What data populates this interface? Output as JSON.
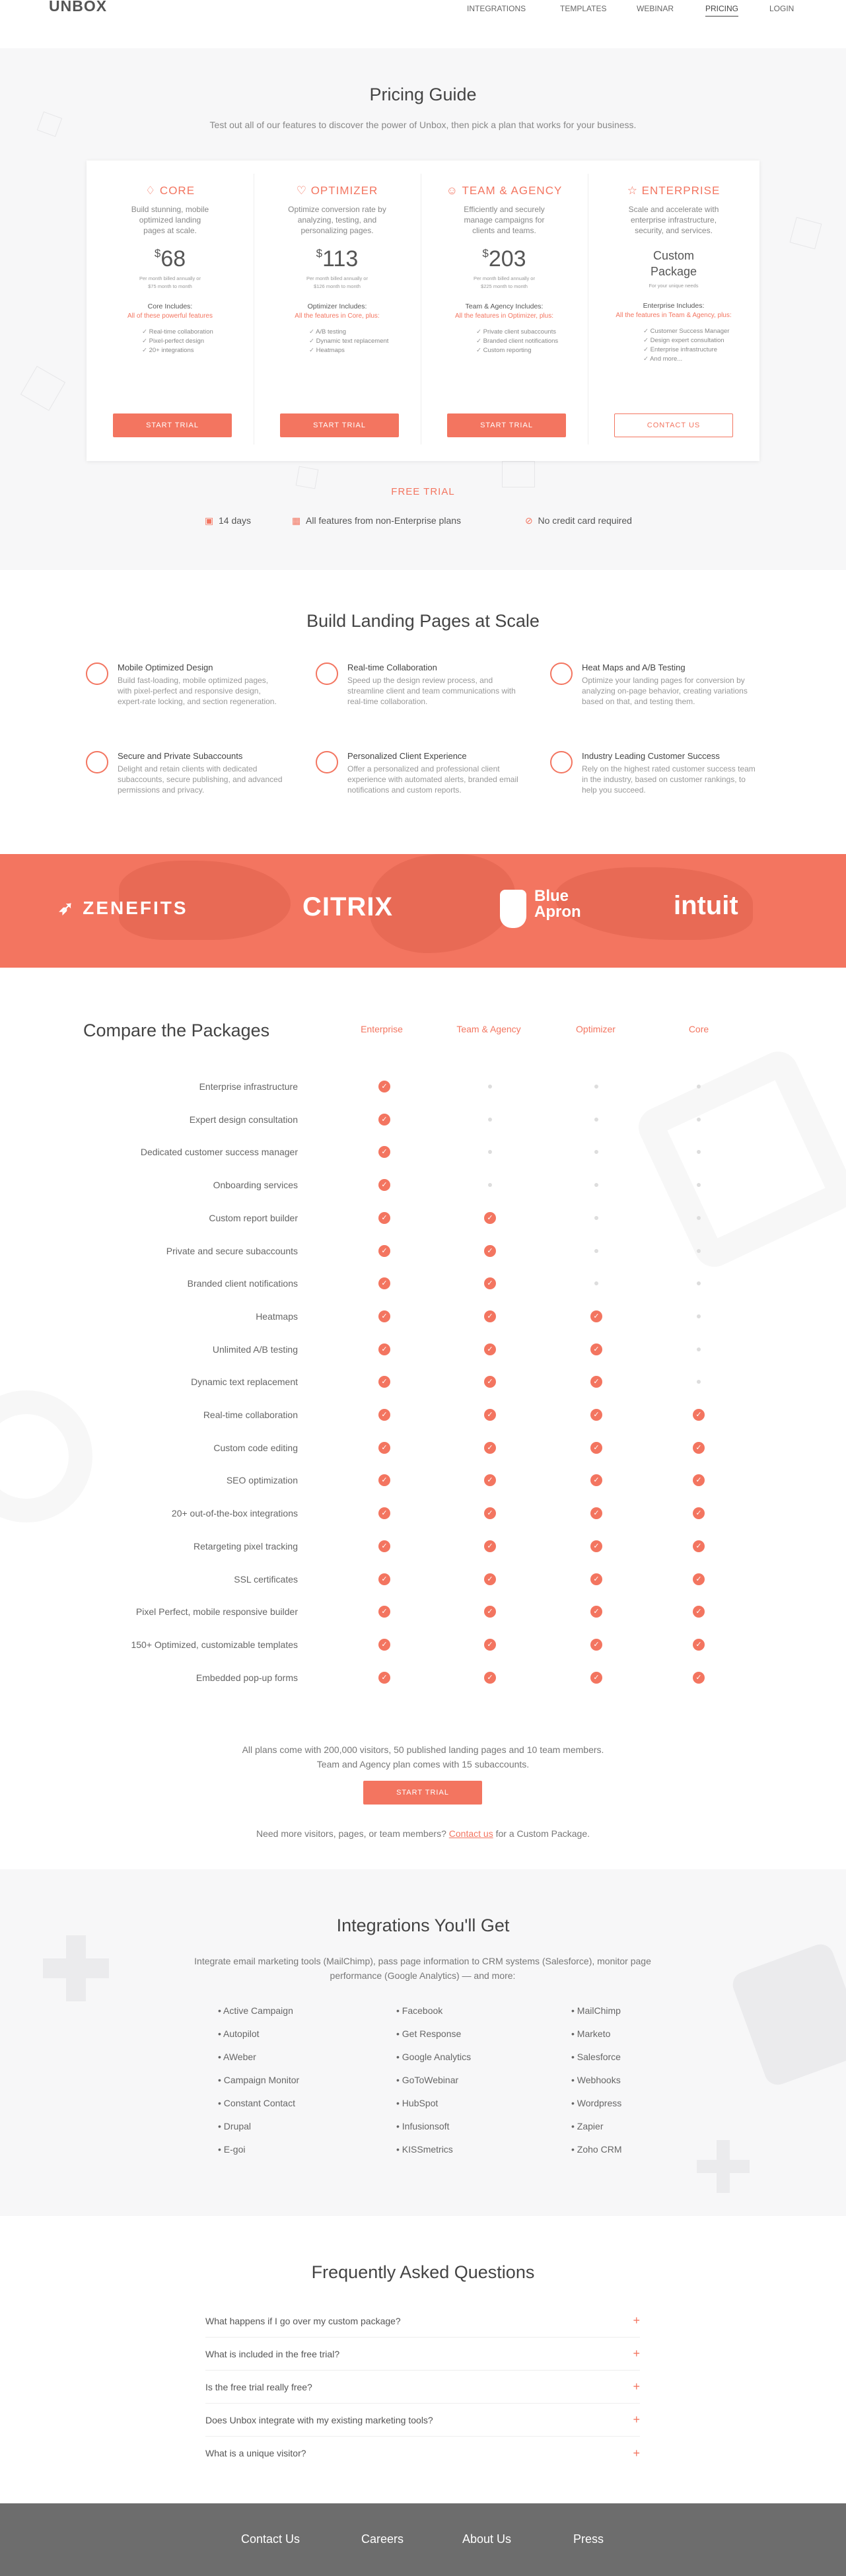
{
  "nav": {
    "logo": "UNBOX",
    "items": [
      "INTEGRATIONS",
      "TEMPLATES",
      "WEBINAR",
      "PRICING",
      "LOGIN"
    ]
  },
  "pricing": {
    "title": "Pricing Guide",
    "subtitle": "Test out all of our features to discover the power of Unbox, then pick a plan that works for your business.",
    "plans": [
      {
        "name": "CORE",
        "desc": "Build stunning, mobile optimized landing pages at scale.",
        "price": "68",
        "note": "Per month billed annually or $75 month to month",
        "includes": "Core Includes:",
        "sub": "All of these powerful features",
        "features": [
          "Real-time collaboration",
          "Pixel-perfect design",
          "20+ integrations"
        ],
        "cta": "START TRIAL"
      },
      {
        "name": "OPTIMIZER",
        "desc": "Optimize conversion rate by analyzing, testing, and personalizing pages.",
        "price": "113",
        "note": "Per month billed annually or $126 month to month",
        "includes": "Optimizer Includes:",
        "sub": "All the features in Core, plus:",
        "features": [
          "A/B testing",
          "Dynamic text replacement",
          "Heatmaps"
        ],
        "cta": "START TRIAL"
      },
      {
        "name": "TEAM & AGENCY",
        "desc": "Efficiently and securely manage campaigns for clients and teams.",
        "price": "203",
        "note": "Per month billed annually or $225 month to month",
        "includes": "Team & Agency Includes:",
        "sub": "All the features in Optimizer, plus:",
        "features": [
          "Private client subaccounts",
          "Branded client notifications",
          "Custom reporting"
        ],
        "cta": "START TRIAL"
      },
      {
        "name": "ENTERPRISE",
        "desc": "Scale and accelerate with enterprise infrastructure, security, and services.",
        "price": "Custom Package",
        "note": "For your unique needs",
        "includes": "Enterprise Includes:",
        "sub": "All the features in Team & Agency, plus:",
        "features": [
          "Customer Success Manager",
          "Design expert consultation",
          "Enterprise infrastructure",
          "And more..."
        ],
        "cta": "CONTACT US"
      }
    ],
    "trial": {
      "title": "FREE TRIAL",
      "items": [
        "14 days",
        "All features from non-Enterprise plans",
        "No credit card required"
      ]
    }
  },
  "scale": {
    "title": "Build Landing Pages at Scale",
    "features": [
      {
        "t": "Mobile Optimized Design",
        "d": "Build fast-loading, mobile optimized pages, with pixel-perfect and responsive design, expert-rate locking, and section regeneration.",
        "icon": "mobile-icon"
      },
      {
        "t": "Real-time Collaboration",
        "d": "Speed up the design review process, and streamline client and team communications with real-time collaboration.",
        "icon": "collaboration-icon"
      },
      {
        "t": "Heat Maps and A/B Testing",
        "d": "Optimize your landing pages for conversion by analyzing on-page behavior, creating variations based on that, and testing them.",
        "icon": "heatmap-icon"
      },
      {
        "t": "Secure and Private Subaccounts",
        "d": "Delight and retain clients with dedicated subaccounts, secure publishing, and advanced permissions and privacy.",
        "icon": "subaccounts-icon"
      },
      {
        "t": "Personalized Client Experience",
        "d": "Offer a personalized and professional client experience with automated alerts, branded email notifications and custom reports.",
        "icon": "client-icon"
      },
      {
        "t": "Industry Leading Customer Success",
        "d": "Rely on the highest rated customer success team in the industry, based on customer rankings, to help you succeed.",
        "icon": "success-icon"
      }
    ]
  },
  "logos": [
    "ZENEFITS",
    "CITRIX",
    "Blue Apron",
    "intuit"
  ],
  "compare": {
    "title": "Compare the Packages",
    "columns": [
      "Enterprise",
      "Team & Agency",
      "Optimizer",
      "Core"
    ],
    "rows": [
      {
        "label": "Enterprise infrastructure",
        "v": [
          1,
          0,
          0,
          0
        ]
      },
      {
        "label": "Expert design consultation",
        "v": [
          1,
          0,
          0,
          0
        ]
      },
      {
        "label": "Dedicated customer success manager",
        "v": [
          1,
          0,
          0,
          0
        ]
      },
      {
        "label": "Onboarding services",
        "v": [
          1,
          0,
          0,
          0
        ]
      },
      {
        "label": "Custom report builder",
        "v": [
          1,
          1,
          0,
          0
        ]
      },
      {
        "label": "Private and secure subaccounts",
        "v": [
          1,
          1,
          0,
          0
        ]
      },
      {
        "label": "Branded client notifications",
        "v": [
          1,
          1,
          0,
          0
        ]
      },
      {
        "label": "Heatmaps",
        "v": [
          1,
          1,
          1,
          0
        ]
      },
      {
        "label": "Unlimited A/B testing",
        "v": [
          1,
          1,
          1,
          0
        ]
      },
      {
        "label": "Dynamic text replacement",
        "v": [
          1,
          1,
          1,
          0
        ]
      },
      {
        "label": "Real-time collaboration",
        "v": [
          1,
          1,
          1,
          1
        ]
      },
      {
        "label": "Custom code editing",
        "v": [
          1,
          1,
          1,
          1
        ]
      },
      {
        "label": "SEO optimization",
        "v": [
          1,
          1,
          1,
          1
        ]
      },
      {
        "label": "20+ out-of-the-box integrations",
        "v": [
          1,
          1,
          1,
          1
        ]
      },
      {
        "label": "Retargeting pixel tracking",
        "v": [
          1,
          1,
          1,
          1
        ]
      },
      {
        "label": "SSL certificates",
        "v": [
          1,
          1,
          1,
          1
        ]
      },
      {
        "label": "Pixel Perfect, mobile responsive builder",
        "v": [
          1,
          1,
          1,
          1
        ]
      },
      {
        "label": "150+ Optimized, customizable templates",
        "v": [
          1,
          1,
          1,
          1
        ]
      },
      {
        "label": "Embedded pop-up forms",
        "v": [
          1,
          1,
          1,
          1
        ]
      }
    ],
    "note1": "All plans come with 200,000 visitors, 50 published landing pages and 10 team members.",
    "note2": "Team and Agency plan comes with 15 subaccounts.",
    "cta": "START TRIAL",
    "more_pre": "Need more visitors, pages, or team members?",
    "more_link": "Contact us",
    "more_post": "for a Custom Package."
  },
  "integrations": {
    "title": "Integrations You'll Get",
    "desc": "Integrate email marketing tools (MailChimp), pass page information to CRM systems (Salesforce), monitor page performance (Google Analytics) — and more:",
    "col1": [
      "Active Campaign",
      "Autopilot",
      "AWeber",
      "Campaign Monitor",
      "Constant Contact",
      "Drupal",
      "E-goi"
    ],
    "col2": [
      "Facebook",
      "Get Response",
      "Google Analytics",
      "GoToWebinar",
      "HubSpot",
      "Infusionsoft",
      "KISSmetrics"
    ],
    "col3": [
      "MailChimp",
      "Marketo",
      "Salesforce",
      "Webhooks",
      "Wordpress",
      "Zapier",
      "Zoho CRM"
    ]
  },
  "faq": {
    "title": "Frequently Asked Questions",
    "items": [
      "What happens if I go over my custom package?",
      "What is included in the free trial?",
      "Is the free trial really free?",
      "Does Unbox integrate with my existing marketing tools?",
      "What is a unique visitor?"
    ]
  },
  "footer": [
    "Contact Us",
    "Careers",
    "About Us",
    "Press"
  ],
  "colors": {
    "accent": "#f37560",
    "footer": "#6d6d6d",
    "band": "#f37560"
  }
}
